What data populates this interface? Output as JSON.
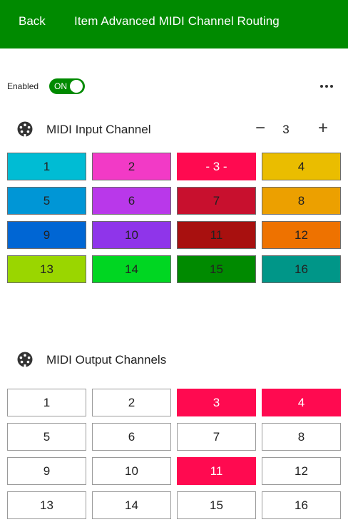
{
  "header": {
    "back_label": "Back",
    "title": "Item Advanced MIDI Channel Routing",
    "background": "#008a00"
  },
  "enabled": {
    "label": "Enabled",
    "toggle_text": "ON"
  },
  "input_section": {
    "title": "MIDI Input Channel",
    "icon": "midi-din-icon",
    "stepper": {
      "minus": "−",
      "value": "3",
      "plus": "+"
    },
    "channels": [
      {
        "label": "1",
        "color": "#00bcd4"
      },
      {
        "label": "2",
        "color": "#f23ac6"
      },
      {
        "label": "- 3 -",
        "color": "#ff0a50"
      },
      {
        "label": "4",
        "color": "#eabd00"
      },
      {
        "label": "5",
        "color": "#0096d6"
      },
      {
        "label": "6",
        "color": "#b938ea"
      },
      {
        "label": "7",
        "color": "#c8102e"
      },
      {
        "label": "8",
        "color": "#eca000"
      },
      {
        "label": "9",
        "color": "#0066d4"
      },
      {
        "label": "10",
        "color": "#8f35ea"
      },
      {
        "label": "11",
        "color": "#a8100f"
      },
      {
        "label": "12",
        "color": "#ee7200"
      },
      {
        "label": "13",
        "color": "#9ad600"
      },
      {
        "label": "14",
        "color": "#00d622"
      },
      {
        "label": "15",
        "color": "#008a00"
      },
      {
        "label": "16",
        "color": "#009688"
      }
    ]
  },
  "output_section": {
    "title": "MIDI Output Channels",
    "icon": "midi-din-icon",
    "active_color": "#ff0a50",
    "channels": [
      {
        "label": "1",
        "active": false
      },
      {
        "label": "2",
        "active": false
      },
      {
        "label": "3",
        "active": true
      },
      {
        "label": "4",
        "active": true
      },
      {
        "label": "5",
        "active": false
      },
      {
        "label": "6",
        "active": false
      },
      {
        "label": "7",
        "active": false
      },
      {
        "label": "8",
        "active": false
      },
      {
        "label": "9",
        "active": false
      },
      {
        "label": "10",
        "active": false
      },
      {
        "label": "11",
        "active": true
      },
      {
        "label": "12",
        "active": false
      },
      {
        "label": "13",
        "active": false
      },
      {
        "label": "14",
        "active": false
      },
      {
        "label": "15",
        "active": false
      },
      {
        "label": "16",
        "active": false
      }
    ]
  }
}
